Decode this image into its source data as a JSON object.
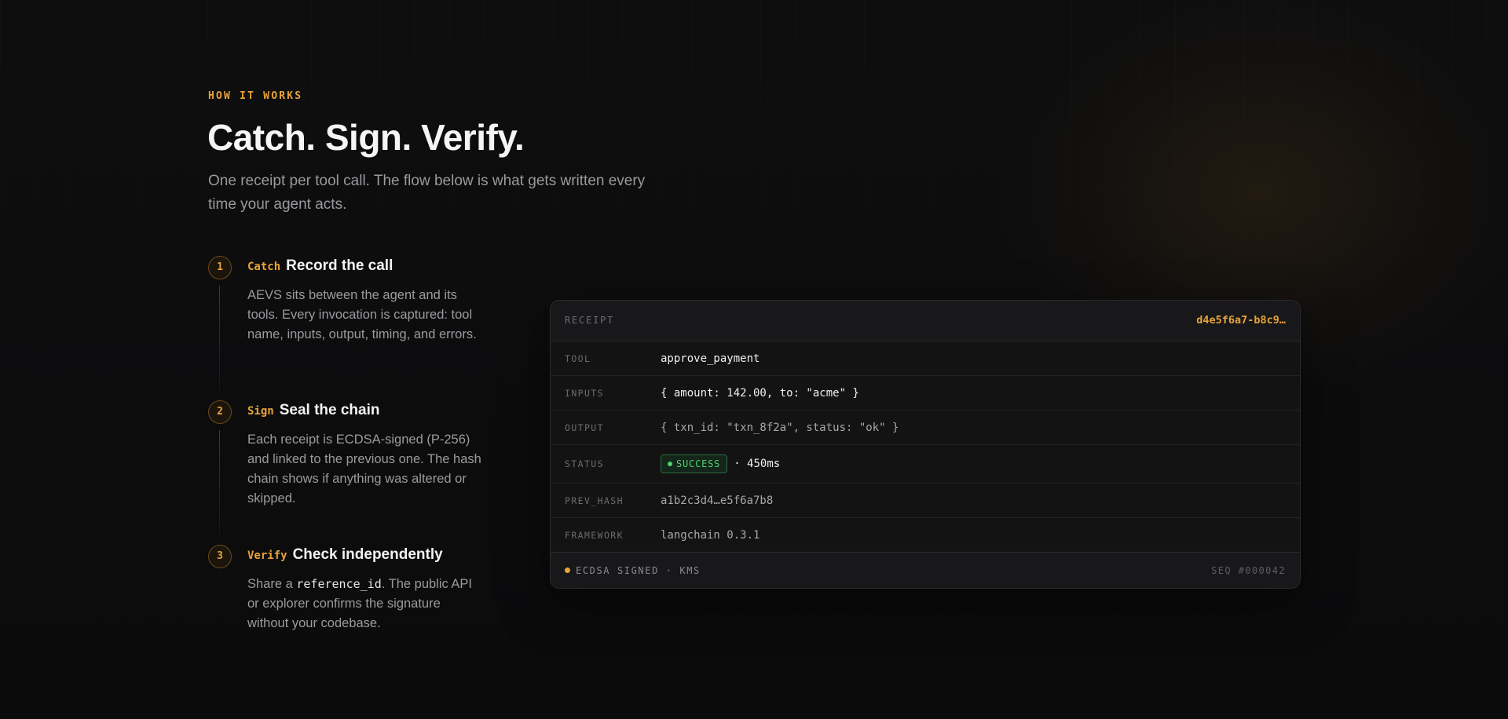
{
  "section": {
    "eyebrow": "HOW IT WORKS",
    "title": "Catch. Sign. Verify.",
    "subtitle": "One receipt per tool call. The flow below is what gets written every time your agent acts."
  },
  "steps": [
    {
      "number": "1",
      "tag": "Catch",
      "title": "Record the call",
      "description": "AEVS sits between the agent and its tools. Every invocation is captured: tool name, inputs, output, timing, and errors."
    },
    {
      "number": "2",
      "tag": "Sign",
      "title": "Seal the chain",
      "description": "Each receipt is ECDSA-signed (P-256) and linked to the previous one. The hash chain shows if anything was altered or skipped."
    },
    {
      "number": "3",
      "tag": "Verify",
      "title": "Check independently",
      "description_before": "Share a ",
      "description_code": "reference_id",
      "description_after": ". The public API or explorer confirms the signature without your codebase."
    }
  ],
  "receipt": {
    "label": "RECEIPT",
    "id": "d4e5f6a7-b8c9…",
    "rows": {
      "tool": {
        "key": "TOOL",
        "value": "approve_payment"
      },
      "inputs": {
        "key": "INPUTS",
        "value": "{ amount: 142.00, to: \"acme\" }"
      },
      "output": {
        "key": "OUTPUT",
        "value": "{ txn_id: \"txn_8f2a\", status: \"ok\" }"
      },
      "status": {
        "key": "STATUS",
        "badge": "SUCCESS",
        "duration": "· 450ms"
      },
      "prev_hash": {
        "key": "PREV_HASH",
        "value": "a1b2c3d4…e5f6a7b8"
      },
      "framework": {
        "key": "FRAMEWORK",
        "value": "langchain 0.3.1"
      }
    },
    "footer": {
      "signed": "ECDSA SIGNED · KMS",
      "sequence": "SEQ #000042"
    }
  },
  "colors": {
    "accent": "#e8a33a",
    "success": "#4fd171",
    "background": "#0c0c0d"
  }
}
